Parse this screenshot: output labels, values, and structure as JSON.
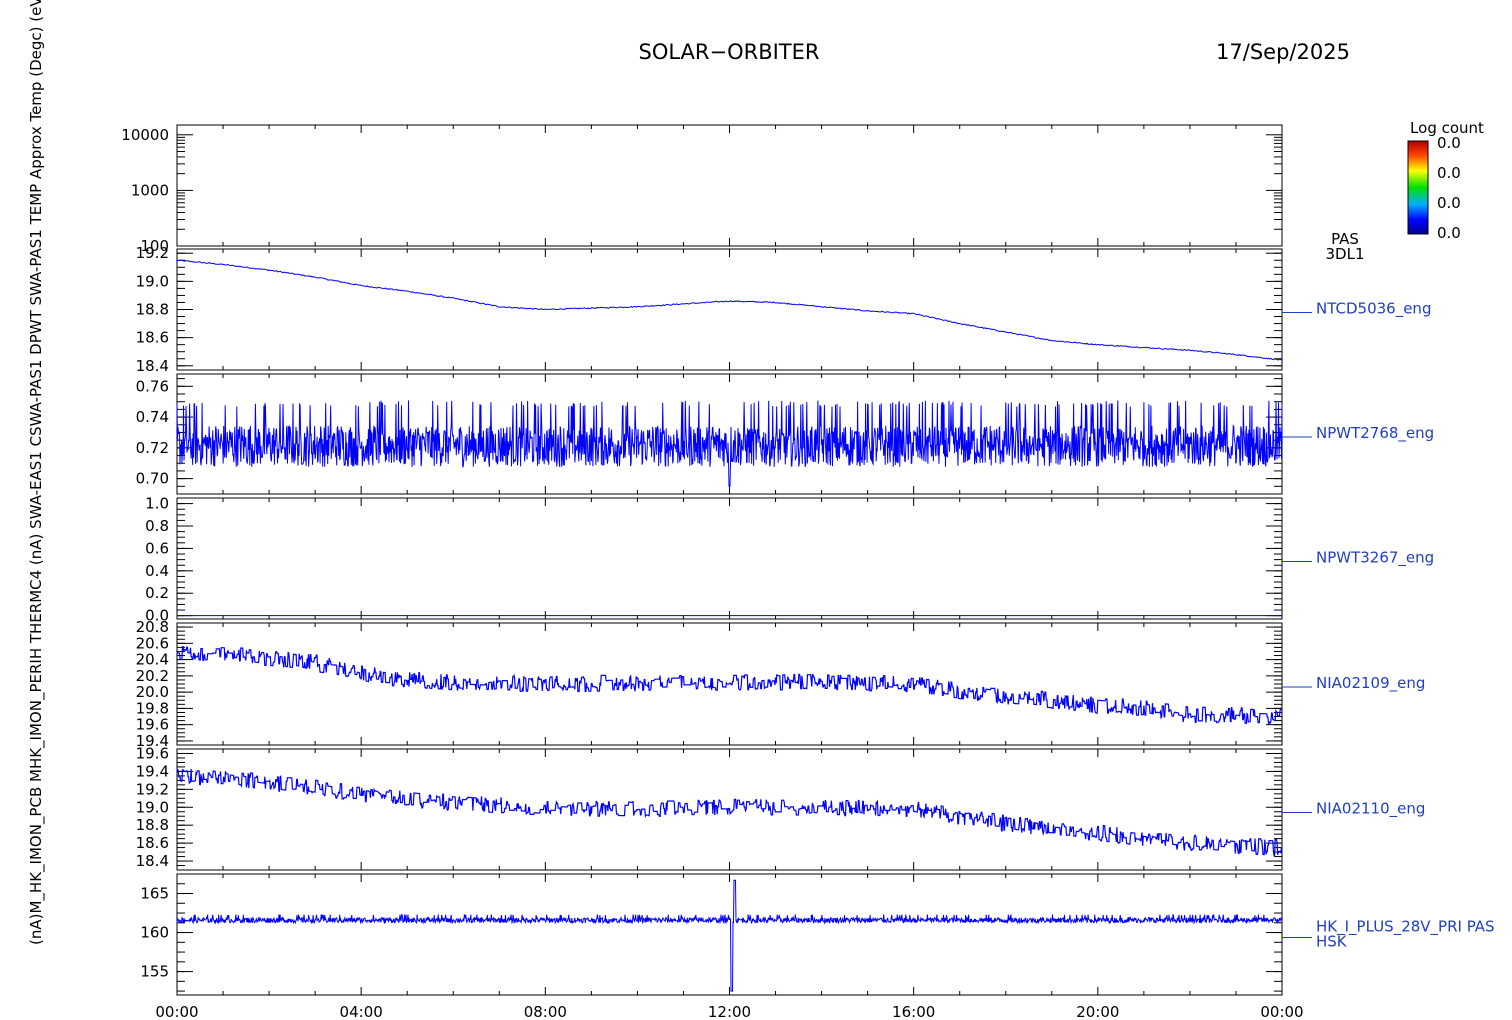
{
  "header": {
    "mission": "SOLAR−ORBITER",
    "date": "17/Sep/2025"
  },
  "colorbar": {
    "title": "Log count",
    "labels": [
      "0.0",
      "0.0",
      "0.0",
      "0.0"
    ]
  },
  "left_axis_label": "(nA)M_HK_IMON_PCB MHK_IMON_PERIH THERMC4 (nA) SWA-EAS1 CSWA-PAS1 DPWT SWA-PAS1 TEMP Approx Temp (Degc) (eV)",
  "colors": {
    "trace": "#0000ff",
    "label": "#1f3fbf",
    "axis": "#000000"
  },
  "chart_data": [
    {
      "type": "heatmap",
      "name_label": [
        "PAS",
        "3DL1"
      ],
      "ylog": true,
      "ylim": [
        100,
        15000
      ],
      "yticks": [
        {
          "v": 100,
          "label": "100"
        },
        {
          "v": 1000,
          "label": "1000"
        },
        {
          "v": 10000,
          "label": "10000"
        }
      ],
      "values": []
    },
    {
      "type": "line",
      "name_label": [
        "NTCD5036_eng"
      ],
      "ylim": [
        18.37,
        19.23
      ],
      "yticks": [
        {
          "v": 18.4,
          "label": "18.4"
        },
        {
          "v": 18.6,
          "label": "18.6"
        },
        {
          "v": 18.8,
          "label": "18.8"
        },
        {
          "v": 19.0,
          "label": "19.0"
        },
        {
          "v": 19.2,
          "label": "19.2"
        }
      ],
      "x": [
        0,
        1,
        2,
        3,
        4,
        5,
        6,
        7,
        8,
        9,
        10,
        11,
        12,
        13,
        14,
        15,
        16,
        17,
        18,
        19,
        20,
        21,
        22,
        23,
        24
      ],
      "y": [
        19.15,
        19.12,
        19.08,
        19.03,
        18.97,
        18.93,
        18.88,
        18.82,
        18.8,
        18.81,
        18.82,
        18.84,
        18.86,
        18.85,
        18.82,
        18.79,
        18.77,
        18.7,
        18.64,
        18.58,
        18.55,
        18.53,
        18.51,
        18.48,
        18.44
      ],
      "noise": 0.004,
      "mode": "smooth"
    },
    {
      "type": "line",
      "name_label": [
        "NPWT2768_eng"
      ],
      "ylim": [
        0.69,
        0.768
      ],
      "yticks": [
        {
          "v": 0.7,
          "label": "0.70"
        },
        {
          "v": 0.72,
          "label": "0.72"
        },
        {
          "v": 0.74,
          "label": "0.74"
        },
        {
          "v": 0.76,
          "label": "0.76"
        }
      ],
      "x": [
        0,
        24
      ],
      "y": [
        0.722,
        0.722
      ],
      "noise": 0.018,
      "mode": "noisy",
      "spike": {
        "x": 12.0,
        "y": 0.695
      }
    },
    {
      "type": "line",
      "name_label": [
        "NPWT3267_eng"
      ],
      "ylim": [
        -0.03,
        1.05
      ],
      "yticks": [
        {
          "v": 0.0,
          "label": "0.0"
        },
        {
          "v": 0.2,
          "label": "0.2"
        },
        {
          "v": 0.4,
          "label": "0.4"
        },
        {
          "v": 0.6,
          "label": "0.6"
        },
        {
          "v": 0.8,
          "label": "0.8"
        },
        {
          "v": 1.0,
          "label": "1.0"
        }
      ],
      "x": [
        0,
        24
      ],
      "y": [
        0.0,
        0.0
      ],
      "noise": 0.0,
      "mode": "flat"
    },
    {
      "type": "line",
      "name_label": [
        "NIA02109_eng"
      ],
      "ylim": [
        19.35,
        20.85
      ],
      "yticks": [
        {
          "v": 19.4,
          "label": "19.4"
        },
        {
          "v": 19.6,
          "label": "19.6"
        },
        {
          "v": 19.8,
          "label": "19.8"
        },
        {
          "v": 20.0,
          "label": "20.0"
        },
        {
          "v": 20.2,
          "label": "20.2"
        },
        {
          "v": 20.4,
          "label": "20.4"
        },
        {
          "v": 20.6,
          "label": "20.6"
        },
        {
          "v": 20.8,
          "label": "20.8"
        }
      ],
      "x": [
        0,
        1.5,
        3,
        4.5,
        6,
        8,
        10,
        12,
        14,
        16,
        17,
        18,
        19,
        20,
        21,
        22,
        23,
        24
      ],
      "y": [
        20.48,
        20.44,
        20.36,
        20.18,
        20.12,
        20.1,
        20.11,
        20.12,
        20.13,
        20.1,
        20.02,
        19.95,
        19.9,
        19.84,
        19.8,
        19.72,
        19.72,
        19.7
      ],
      "noise": 0.1,
      "mode": "stepped"
    },
    {
      "type": "line",
      "name_label": [
        "NIA02110_eng"
      ],
      "ylim": [
        18.3,
        19.65
      ],
      "yticks": [
        {
          "v": 18.4,
          "label": "18.4"
        },
        {
          "v": 18.6,
          "label": "18.6"
        },
        {
          "v": 18.8,
          "label": "18.8"
        },
        {
          "v": 19.0,
          "label": "19.0"
        },
        {
          "v": 19.2,
          "label": "19.2"
        },
        {
          "v": 19.4,
          "label": "19.4"
        },
        {
          "v": 19.6,
          "label": "19.6"
        }
      ],
      "x": [
        0,
        1.5,
        3,
        4.5,
        6,
        8,
        10,
        12,
        14,
        16,
        17,
        18,
        19,
        20,
        21,
        22,
        23,
        24
      ],
      "y": [
        19.35,
        19.3,
        19.22,
        19.12,
        19.05,
        19.0,
        18.98,
        19.0,
        19.0,
        18.98,
        18.9,
        18.82,
        18.75,
        18.72,
        18.65,
        18.6,
        18.57,
        18.55
      ],
      "noise": 0.09,
      "mode": "stepped"
    },
    {
      "type": "line",
      "name_label": [
        "HK_I_PLUS_28V_PRI PAS",
        "HSK"
      ],
      "ylim": [
        152,
        167.5
      ],
      "yticks": [
        {
          "v": 155,
          "label": "155"
        },
        {
          "v": 160,
          "label": "160"
        },
        {
          "v": 165,
          "label": "165"
        }
      ],
      "x": [
        0,
        24
      ],
      "y": [
        161.6,
        161.6
      ],
      "noise": 0.45,
      "mode": "noisy",
      "spike": {
        "x": 12.05,
        "y": 152.5,
        "y2": 166.7
      }
    }
  ],
  "x_axis": {
    "range": [
      0,
      24
    ],
    "ticks": [
      {
        "v": 0,
        "label": "00:00"
      },
      {
        "v": 4,
        "label": "04:00"
      },
      {
        "v": 8,
        "label": "08:00"
      },
      {
        "v": 12,
        "label": "12:00"
      },
      {
        "v": 16,
        "label": "16:00"
      },
      {
        "v": 20,
        "label": "20:00"
      },
      {
        "v": 24,
        "label": "00:00"
      }
    ]
  }
}
